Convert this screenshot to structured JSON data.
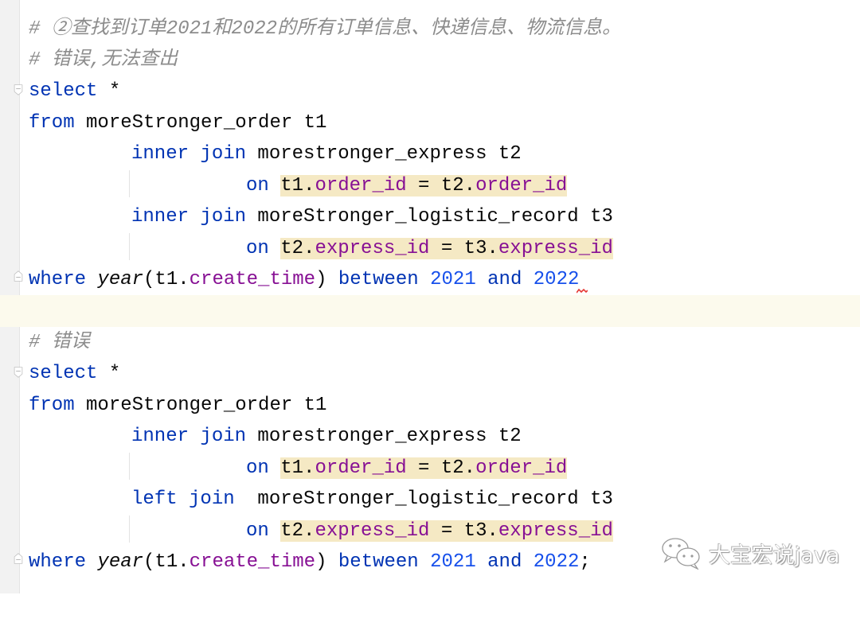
{
  "editor": {
    "colors": {
      "keyword": "#0033b3",
      "number": "#1750eb",
      "field": "#871094",
      "comment": "#8c8c8c",
      "highlight": "#f5e9c4",
      "current_line": "#fcfaed"
    },
    "query1": {
      "comment1": "# ②查找到订单2021和2022的所有订单信息、快递信息、物流信息。",
      "comment2": "# 错误,无法查出",
      "select_kw": "select",
      "star": " *",
      "from_kw": "from",
      "from_table": " moreStronger_order t1",
      "join1_kw": "inner join",
      "join1_table": " morestronger_express t2",
      "on1_kw": "on",
      "on1_a": "t1.",
      "on1_a_field": "order_id",
      "on1_eq": " = t2.",
      "on1_b_field": "order_id",
      "join2_kw": "inner join",
      "join2_table": " moreStronger_logistic_record t3",
      "on2_kw": "on",
      "on2_a": "t2.",
      "on2_a_field": "express_id",
      "on2_eq": " = t3.",
      "on2_b_field": "express_id",
      "where_kw": "where",
      "where_fn": "year",
      "where_open": "(t1.",
      "where_field": "create_time",
      "where_close": ") ",
      "between_kw": "between",
      "num1": "2021",
      "and_kw": "and",
      "num2": "2022",
      "terminator": ""
    },
    "query2": {
      "comment1": "# 错误",
      "select_kw": "select",
      "star": " *",
      "from_kw": "from",
      "from_table": " moreStronger_order t1",
      "join1_kw": "inner join",
      "join1_table": " morestronger_express t2",
      "on1_kw": "on",
      "on1_a": "t1.",
      "on1_a_field": "order_id",
      "on1_eq": " = t2.",
      "on1_b_field": "order_id",
      "join2_kw": "left join",
      "join2_table": "  moreStronger_logistic_record t3",
      "on2_kw": "on",
      "on2_a": "t2.",
      "on2_a_field": "express_id",
      "on2_eq": " = t3.",
      "on2_b_field": "express_id",
      "where_kw": "where",
      "where_fn": "year",
      "where_open": "(t1.",
      "where_field": "create_time",
      "where_close": ") ",
      "between_kw": "between",
      "num1": "2021",
      "and_kw": "and",
      "num2": "2022",
      "terminator": ";"
    }
  },
  "watermark": {
    "icon": "wechat-icon",
    "text": "大宝宏说java"
  }
}
